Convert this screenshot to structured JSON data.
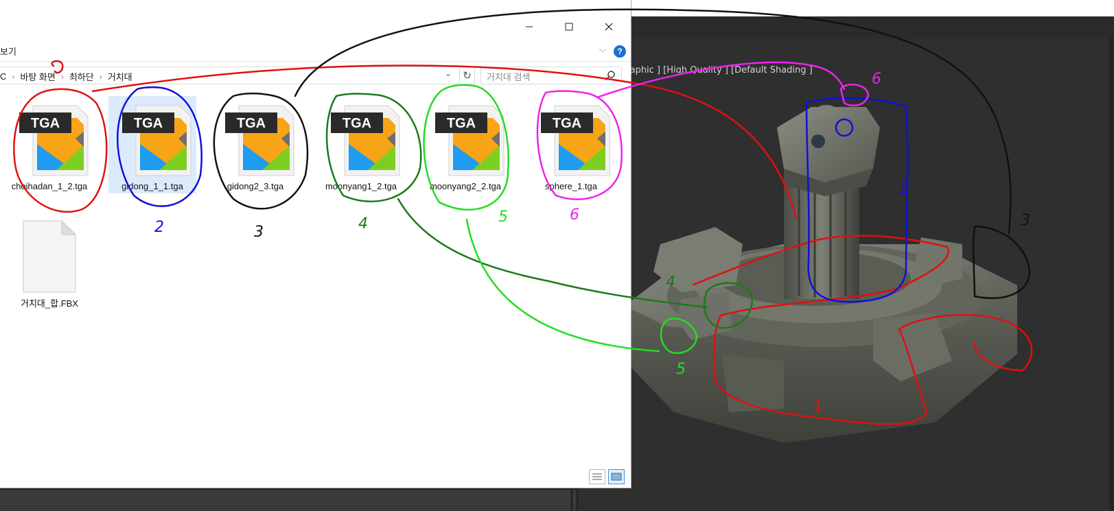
{
  "viewport": {
    "label": "graphic ] [High Quality ] [Default Shading ]"
  },
  "explorer": {
    "ribbon_tab": "보기",
    "help_label": "?",
    "breadcrumb": [
      "C",
      "바탕 화면",
      "최하단",
      "거치대"
    ],
    "search_placeholder": "거치대 검색",
    "files": [
      {
        "name": "choihadan_1_2.tga",
        "type": "TGA",
        "selected": false
      },
      {
        "name": "gidong_1_1.tga",
        "type": "TGA",
        "selected": true
      },
      {
        "name": "gidong2_3.tga",
        "type": "TGA",
        "selected": false
      },
      {
        "name": "moonyang1_2.tga",
        "type": "TGA",
        "selected": false
      },
      {
        "name": "moonyang2_2.tga",
        "type": "TGA",
        "selected": false
      },
      {
        "name": "sphere_1.tga",
        "type": "TGA",
        "selected": false
      },
      {
        "name": "거치대_합.FBX",
        "type": "FBX",
        "selected": false
      }
    ]
  },
  "annotations": {
    "numbers": [
      "1",
      "2",
      "3",
      "4",
      "5",
      "6"
    ],
    "colors": {
      "red": "#e01010",
      "blue": "#1010d8",
      "black": "#111111",
      "dark_green": "#1a7a1a",
      "green": "#22dd22",
      "magenta": "#ee22ee"
    }
  },
  "colors": {
    "tga_orange": "#f7a416",
    "tga_blue": "#1e9cf0",
    "tga_green": "#7ccf1f",
    "tga_badge": "#2a2a2a",
    "selection": "#dcebfb",
    "viewport_bg": "#2f2f2f"
  }
}
